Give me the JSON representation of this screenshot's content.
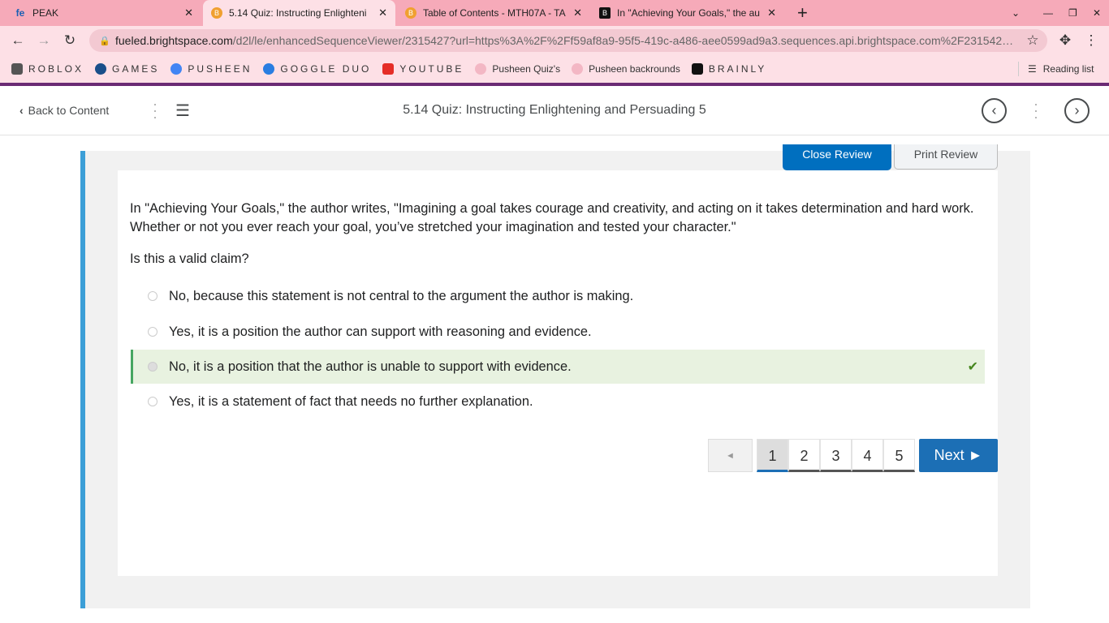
{
  "browser": {
    "tabs": [
      {
        "title": "PEAK",
        "icon": "fe"
      },
      {
        "title": "5.14 Quiz: Instructing Enlighteni",
        "icon": "B"
      },
      {
        "title": "Table of Contents - MTH07A - TA",
        "icon": "B"
      },
      {
        "title": "In \"Achieving Your Goals,\" the au",
        "icon": "B"
      }
    ],
    "url_host": "fueled.brightspace.com",
    "url_rest": "/d2l/le/enhancedSequenceViewer/2315427?url=https%3A%2F%2Ff59af8a9-95f5-419c-a486-aee0599ad9a3.sequences.api.brightspace.com%2F231542…",
    "bookmarks": [
      "ROBLOX",
      "GAMES",
      "PUSHEEN",
      "GOGGLE DUO",
      "YOUTUBE",
      "Pusheen Quiz's",
      "Pusheen backrounds",
      "BRAINLY"
    ],
    "reading_list": "Reading list"
  },
  "header": {
    "back": "Back to Content",
    "title": "5.14 Quiz: Instructing Enlightening and Persuading 5"
  },
  "review": {
    "close": "Close Review",
    "print": "Print Review"
  },
  "question": {
    "text": "In \"Achieving Your Goals,\" the author writes, \"Imagining a goal takes courage and creativity, and acting on it takes determination and hard work. Whether or not you ever reach your goal, you’ve stretched your imagination and tested your character.\"",
    "prompt": "Is this a valid claim?",
    "options": [
      "No, because this statement is not central to the argument the author is making.",
      "Yes, it is a position the author can support with reasoning and evidence.",
      "No, it is a position that the author is unable to support with evidence.",
      "Yes, it is a statement of fact that needs no further explanation."
    ],
    "selected_index": 2
  },
  "pager": {
    "prev": "◄",
    "pages": [
      "1",
      "2",
      "3",
      "4",
      "5"
    ],
    "current": "1",
    "next": "Next ►"
  }
}
